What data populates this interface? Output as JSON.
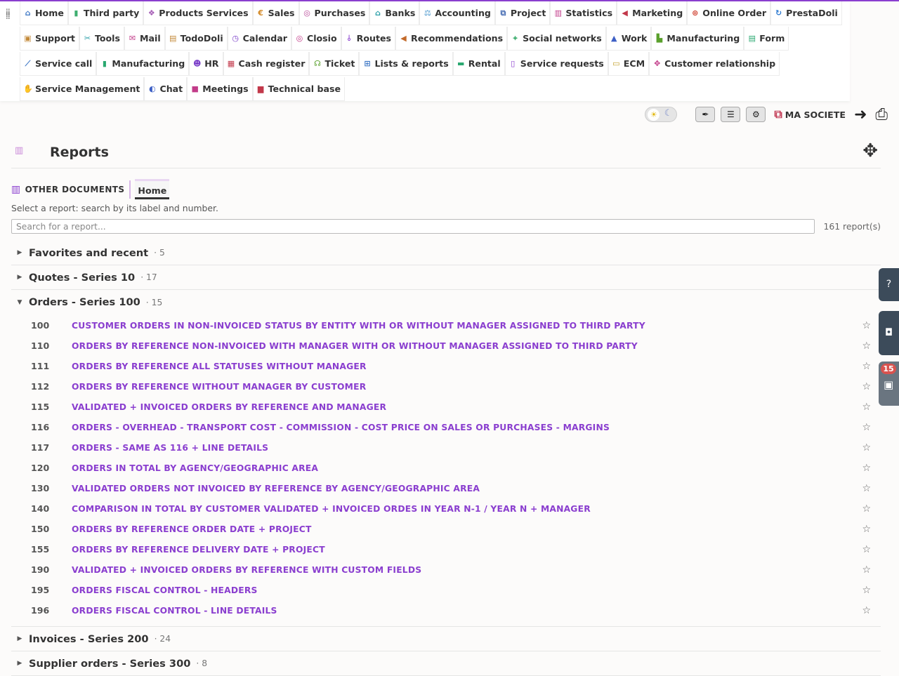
{
  "menu": {
    "rows": [
      [
        {
          "label": "Home",
          "icon": "home-icon",
          "glyph": "⌂",
          "color": "#3d77c5"
        },
        {
          "label": "Third party",
          "icon": "building-icon",
          "glyph": "▮",
          "color": "#3fae70"
        },
        {
          "label": "Products Services",
          "icon": "cubes-icon",
          "glyph": "❖",
          "color": "#a45bb5"
        },
        {
          "label": "Sales",
          "icon": "euro-icon",
          "glyph": "€",
          "color": "#d48a28"
        },
        {
          "label": "Purchases",
          "icon": "coins-icon",
          "glyph": "◎",
          "color": "#b94c9a"
        },
        {
          "label": "Banks",
          "icon": "bank-icon",
          "glyph": "⌂",
          "color": "#2a9fa8"
        },
        {
          "label": "Accounting",
          "icon": "scale-icon",
          "glyph": "⚖",
          "color": "#3c8fc9"
        },
        {
          "label": "Project",
          "icon": "sitemap-icon",
          "glyph": "⧉",
          "color": "#4a6fb5"
        },
        {
          "label": "Statistics",
          "icon": "chart-icon",
          "glyph": "▥",
          "color": "#c23b89"
        },
        {
          "label": "Marketing",
          "icon": "bullhorn-icon",
          "glyph": "◀",
          "color": "#c2384a"
        },
        {
          "label": "Online Order",
          "icon": "online-order-icon",
          "glyph": "⊛",
          "color": "#d24a3a"
        },
        {
          "label": "PrestaDoli",
          "icon": "sync-icon",
          "glyph": "↻",
          "color": "#2f7bd1"
        }
      ],
      [
        {
          "label": "Support",
          "icon": "briefcase-icon",
          "glyph": "▣",
          "color": "#c38a3a"
        },
        {
          "label": "Tools",
          "icon": "tools-icon",
          "glyph": "✂",
          "color": "#2a9fa8"
        },
        {
          "label": "Mail",
          "icon": "mail-icon",
          "glyph": "✉",
          "color": "#c23b89"
        },
        {
          "label": "TodoDoli",
          "icon": "calendar-check-icon",
          "glyph": "▤",
          "color": "#c38a3a"
        },
        {
          "label": "Calendar",
          "icon": "clock-icon",
          "glyph": "◷",
          "color": "#7b3fc9"
        },
        {
          "label": "Closio",
          "icon": "target-icon",
          "glyph": "◎",
          "color": "#c23b89"
        },
        {
          "label": "Routes",
          "icon": "route-icon",
          "glyph": "⫰",
          "color": "#8a3ecf"
        },
        {
          "label": "Recommendations",
          "icon": "bullhorn-icon",
          "glyph": "◀",
          "color": "#c36a2a"
        },
        {
          "label": "Social networks",
          "icon": "broadcast-icon",
          "glyph": "⌖",
          "color": "#3fae70"
        },
        {
          "label": "Work",
          "icon": "road-icon",
          "glyph": "▲",
          "color": "#3d5fc5"
        },
        {
          "label": "Manufacturing",
          "icon": "industry-icon",
          "glyph": "▙",
          "color": "#5aa02c"
        },
        {
          "label": "Form",
          "icon": "form-icon",
          "glyph": "▤",
          "color": "#2aa870"
        }
      ],
      [
        {
          "label": "Service call",
          "icon": "brush-icon",
          "glyph": "⟋",
          "color": "#3d77c5"
        },
        {
          "label": "Manufacturing",
          "icon": "cube-icon",
          "glyph": "▮",
          "color": "#2aa870"
        },
        {
          "label": "HR",
          "icon": "users-icon",
          "glyph": "☻",
          "color": "#7b3fc9"
        },
        {
          "label": "Cash register",
          "icon": "cash-register-icon",
          "glyph": "▦",
          "color": "#c2384a"
        },
        {
          "label": "Ticket",
          "icon": "headset-icon",
          "glyph": "☊",
          "color": "#5aa02c"
        },
        {
          "label": "Lists & reports",
          "icon": "table-icon",
          "glyph": "⊞",
          "color": "#3d77c5"
        },
        {
          "label": "Rental",
          "icon": "truck-icon",
          "glyph": "▬",
          "color": "#2aa870"
        },
        {
          "label": "Service requests",
          "icon": "file-icon",
          "glyph": "▯",
          "color": "#8a3ecf"
        },
        {
          "label": "ECM",
          "icon": "folder-icon",
          "glyph": "▭",
          "color": "#c3a02a"
        },
        {
          "label": "Customer relationship",
          "icon": "handshake-icon",
          "glyph": "✥",
          "color": "#c23b89"
        }
      ],
      [
        {
          "label": "Service Management",
          "icon": "hands-icon",
          "glyph": "✋",
          "color": "#2aa870"
        },
        {
          "label": "Chat",
          "icon": "comments-icon",
          "glyph": "◐",
          "color": "#3d5fc5"
        },
        {
          "label": "Meetings",
          "icon": "video-icon",
          "glyph": "■",
          "color": "#c23b89"
        },
        {
          "label": "Technical base",
          "icon": "book-icon",
          "glyph": "▆",
          "color": "#c2384a"
        }
      ]
    ]
  },
  "header": {
    "company": "MA SOCIETE"
  },
  "page": {
    "title": "Reports",
    "tab_other": "OTHER DOCUMENTS",
    "tab_home": "Home",
    "hint": "Select a report: search by its label and number.",
    "search_placeholder": "Search for a report...",
    "count": "161 report(s)"
  },
  "groups": [
    {
      "name": "Favorites and recent",
      "count": "· 5",
      "expanded": false
    },
    {
      "name": "Quotes - Series 10",
      "count": "· 17",
      "expanded": false
    },
    {
      "name": "Orders - Series 100",
      "count": "· 15",
      "expanded": true
    },
    {
      "name": "Invoices - Series 200",
      "count": "· 24",
      "expanded": false
    },
    {
      "name": "Supplier orders - Series 300",
      "count": "· 8",
      "expanded": false
    }
  ],
  "reports": [
    {
      "num": "100",
      "label": "CUSTOMER ORDERS IN NON-INVOICED STATUS BY ENTITY WITH OR WITHOUT MANAGER ASSIGNED TO THIRD PARTY"
    },
    {
      "num": "110",
      "label": "ORDERS BY REFERENCE NON-INVOICED WITH MANAGER WITH OR WITHOUT MANAGER ASSIGNED TO THIRD PARTY"
    },
    {
      "num": "111",
      "label": "ORDERS BY REFERENCE ALL STATUSES WITHOUT MANAGER"
    },
    {
      "num": "112",
      "label": "ORDERS BY REFERENCE WITHOUT MANAGER BY CUSTOMER"
    },
    {
      "num": "115",
      "label": "VALIDATED + INVOICED ORDERS BY REFERENCE AND MANAGER"
    },
    {
      "num": "116",
      "label": "ORDERS - OVERHEAD - TRANSPORT COST - COMMISSION - COST PRICE ON SALES OR PURCHASES - MARGINS"
    },
    {
      "num": "117",
      "label": "ORDERS - SAME AS 116 + LINE DETAILS"
    },
    {
      "num": "120",
      "label": "ORDERS IN TOTAL BY AGENCY/GEOGRAPHIC AREA"
    },
    {
      "num": "130",
      "label": "VALIDATED ORDERS NOT INVOICED BY REFERENCE BY AGENCY/GEOGRAPHIC AREA"
    },
    {
      "num": "140",
      "label": "COMPARISON IN TOTAL BY CUSTOMER VALIDATED + INVOICED ORDES IN YEAR N-1 / YEAR N + MANAGER"
    },
    {
      "num": "150",
      "label": "ORDERS BY REFERENCE ORDER DATE + PROJECT"
    },
    {
      "num": "155",
      "label": "ORDERS BY REFERENCE DELIVERY DATE + PROJECT"
    },
    {
      "num": "190",
      "label": "VALIDATED + INVOICED ORDERS BY REFERENCE WITH CUSTOM FIELDS"
    },
    {
      "num": "195",
      "label": "ORDERS FISCAL CONTROL - HEADERS"
    },
    {
      "num": "196",
      "label": "ORDERS FISCAL CONTROL - LINE DETAILS"
    }
  ],
  "sidebar_widgets": {
    "agenda_badge": "15"
  },
  "colors": {
    "accent": "#8a3ecf",
    "side_panel": "#3c4b5a",
    "badge": "#d9534f"
  }
}
